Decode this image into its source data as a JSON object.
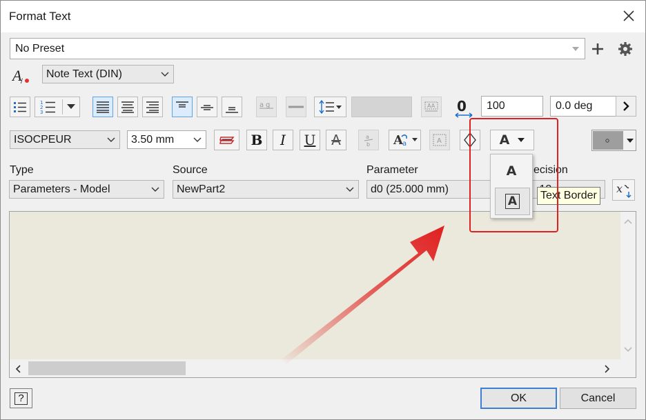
{
  "window": {
    "title": "Format Text",
    "close_icon": "close-icon"
  },
  "preset": {
    "value": "No Preset",
    "add_icon": "plus-icon",
    "settings_icon": "gear-icon"
  },
  "style": {
    "icon": "text-style-icon",
    "value": "Note Text (DIN)"
  },
  "toolbar1": {
    "bullets": "bulleted-list-icon",
    "numbers": "numbered-list-icon",
    "align": [
      "align-left-icon",
      "align-center-icon",
      "align-right-icon"
    ],
    "valign": [
      "align-top-icon",
      "align-middle-icon",
      "align-bottom-icon"
    ],
    "stack": "stack-icon",
    "line": "line-icon",
    "spacing": "line-spacing-icon",
    "width_icon": "width-factor-icon",
    "width_value": "100",
    "rotation_value": "0.0 deg",
    "more": "expand-arrow-icon"
  },
  "toolbar2": {
    "font": "ISOCPEUR",
    "size": "3.50 mm",
    "bold": "B",
    "italic": "I",
    "underline": "U",
    "strike": "A",
    "text_border_button": "A",
    "color_swatch": "#9e9e9e"
  },
  "border_menu": {
    "items": [
      {
        "label": "A",
        "name": "no-border"
      },
      {
        "label": "A",
        "name": "text-border"
      }
    ],
    "tooltip": "Text Border"
  },
  "parameters": {
    "type_label": "Type",
    "type_value": "Parameters - Model",
    "source_label": "Source",
    "source_value": "NewPart2",
    "parameter_label": "Parameter",
    "parameter_value": "d0 (25.000 mm)",
    "precision_label": "ecision",
    "precision_value": ".12",
    "insert_icon": "insert-parameter-icon"
  },
  "footer": {
    "help": "?",
    "ok": "OK",
    "cancel": "Cancel"
  },
  "colors": {
    "highlight": "#e02020",
    "accent": "#3c7fd2"
  }
}
